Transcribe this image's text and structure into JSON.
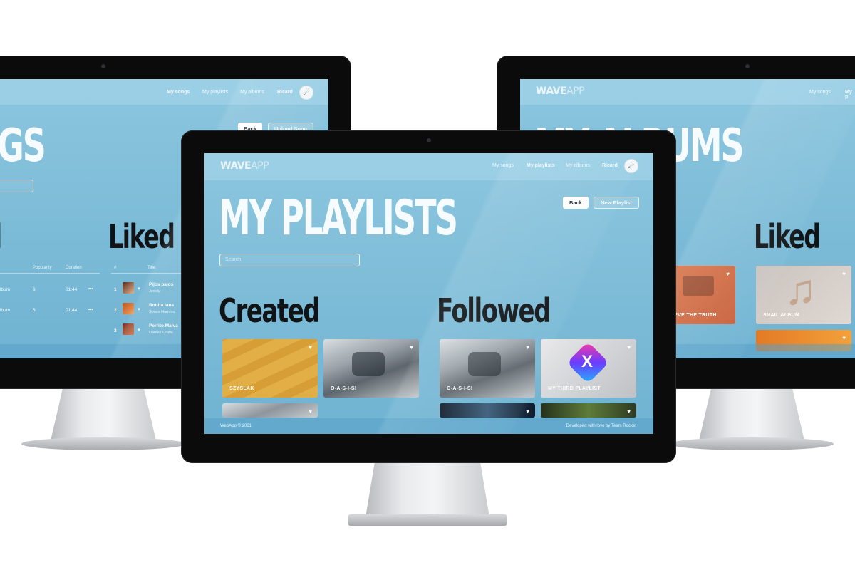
{
  "center": {
    "logo": {
      "bold": "WAVE",
      "light": "APP"
    },
    "nav": {
      "songs": "My songs",
      "playlists": "My playlists",
      "albums": "My albums",
      "user": "Ricard"
    },
    "title": "MY PLAYLISTS",
    "buttons": {
      "back": "Back",
      "new": "New Playlist"
    },
    "search_placeholder": "Search",
    "created": {
      "heading": "Created",
      "cards": [
        {
          "label": "SZYSLAK"
        },
        {
          "label": "O-A-S-I-S!"
        },
        {
          "label": ""
        }
      ]
    },
    "followed": {
      "heading": "Followed",
      "cards": [
        {
          "label": "O-A-S-I-S!"
        },
        {
          "label": "MY THIRD PLAYLIST"
        },
        {
          "label": ""
        },
        {
          "label": ""
        }
      ]
    },
    "footer": {
      "left": "WebApp © 2021",
      "right": "Developed with love by Team Rocket"
    }
  },
  "left": {
    "nav": {
      "songs": "My songs",
      "playlists": "My playlists",
      "albums": "My albums",
      "user": "Ricard"
    },
    "title": "GS",
    "buttons": {
      "back": "Back",
      "upload": "Upload Song"
    },
    "liked_heading": "Liked",
    "columns": {
      "popularity": "Popularity",
      "duration": "Duration",
      "num": "#",
      "title": "Title"
    },
    "left_rows": [
      {
        "album": "lbum",
        "popularity": "6",
        "duration": "01:44",
        "more": "•••"
      },
      {
        "album": "lbum",
        "popularity": "6",
        "duration": "01:44",
        "more": "•••"
      }
    ],
    "liked_rows": [
      {
        "num": "1",
        "title": "Pijos pajos",
        "artist": "Jesuly"
      },
      {
        "num": "2",
        "title": "Bonita lana",
        "artist": "Space Hammu"
      },
      {
        "num": "3",
        "title": "Perrito Malva",
        "artist": "Damas Gratis"
      }
    ]
  },
  "right": {
    "logo": {
      "bold": "WAVE",
      "light": "APP"
    },
    "nav": {
      "songs": "My songs",
      "playlists": "My p"
    },
    "title": "MY ALBUMS",
    "liked_heading": "Liked",
    "cards": [
      {
        "label": "IEVE THE TRUTH"
      },
      {
        "label": "SNAIL ALBUM"
      }
    ]
  },
  "icons": {
    "heart": "♥",
    "avatar": "avatar-icon"
  },
  "colors": {
    "screen": "#7fbdd8",
    "dark_text": "#101417",
    "bezel": "#0b0b0c"
  }
}
